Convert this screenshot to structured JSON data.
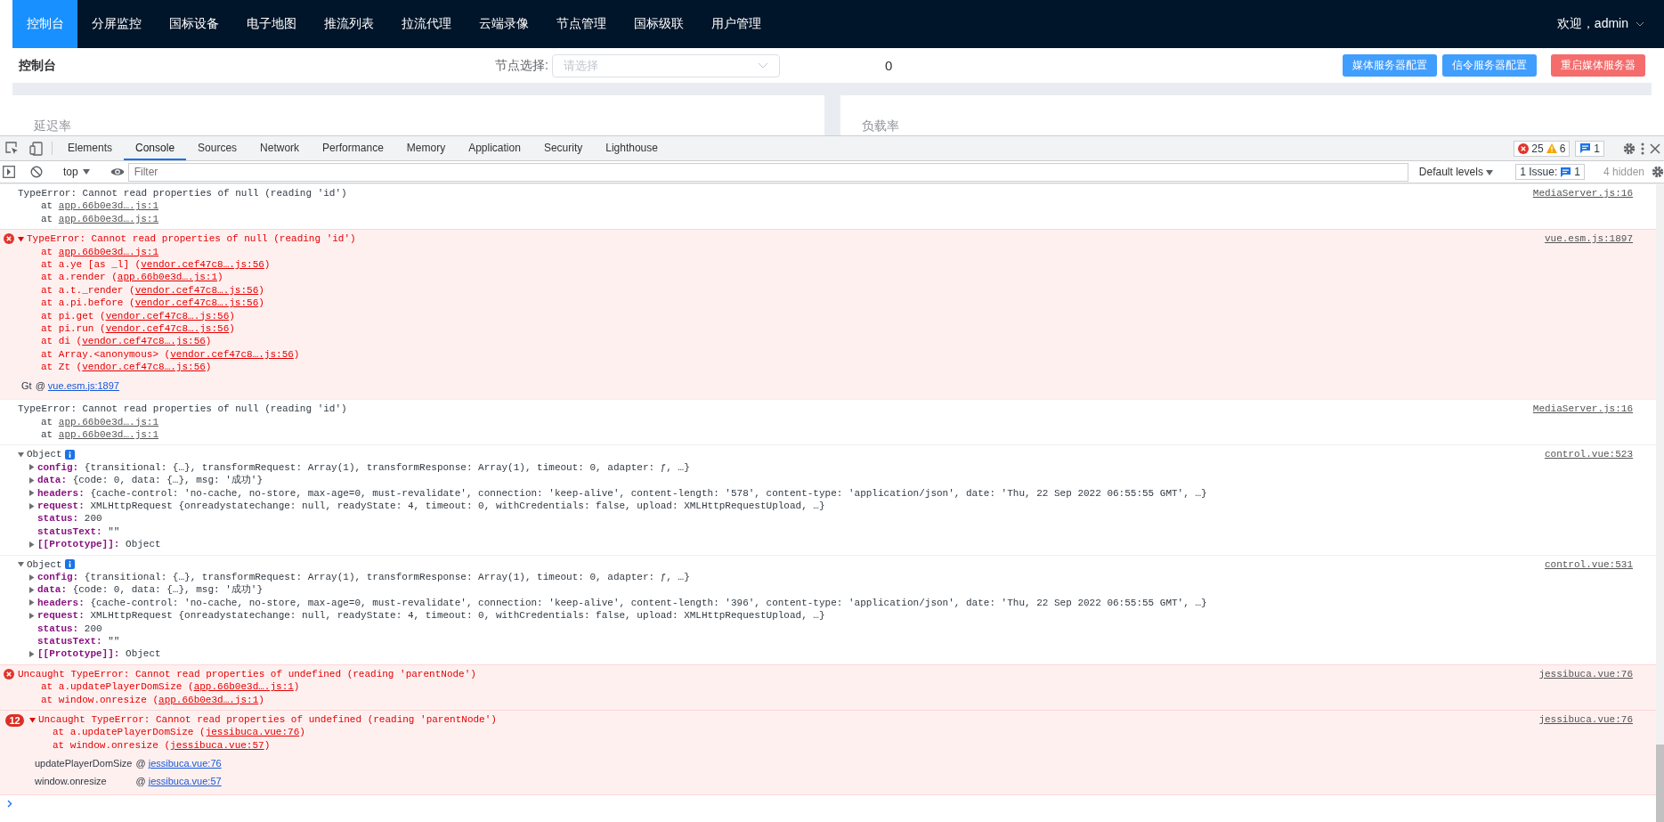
{
  "nav": {
    "items": [
      {
        "label": "控制台",
        "selected": true
      },
      {
        "label": "分屏监控",
        "selected": false
      },
      {
        "label": "国标设备",
        "selected": false
      },
      {
        "label": "电子地图",
        "selected": false
      },
      {
        "label": "推流列表",
        "selected": false
      },
      {
        "label": "拉流代理",
        "selected": false
      },
      {
        "label": "云端录像",
        "selected": false
      },
      {
        "label": "节点管理",
        "selected": false
      },
      {
        "label": "国标级联",
        "selected": false
      },
      {
        "label": "用户管理",
        "selected": false
      }
    ],
    "user": "欢迎，admin"
  },
  "header": {
    "title": "控制台",
    "node_label": "节点选择:",
    "node_placeholder": "请选择",
    "count": "0",
    "buttons": [
      {
        "label": "媒体服务器配置",
        "kind": "primary"
      },
      {
        "label": "信令服务器配置",
        "kind": "primary"
      },
      {
        "label": "重启媒体服务器",
        "kind": "danger"
      }
    ]
  },
  "cards": [
    {
      "title": "延迟率"
    },
    {
      "title": "负载率"
    }
  ],
  "devtools": {
    "tabs": [
      {
        "label": "Elements",
        "selected": false
      },
      {
        "label": "Console",
        "selected": true
      },
      {
        "label": "Sources",
        "selected": false
      },
      {
        "label": "Network",
        "selected": false
      },
      {
        "label": "Performance",
        "selected": false
      },
      {
        "label": "Memory",
        "selected": false
      },
      {
        "label": "Application",
        "selected": false
      },
      {
        "label": "Security",
        "selected": false
      },
      {
        "label": "Lighthouse",
        "selected": false
      }
    ],
    "errors": "25",
    "warnings": "6",
    "issues": "1",
    "context": "top",
    "filter_placeholder": "Filter",
    "levels": "Default levels",
    "issue_label": "1 Issue:",
    "issue_count": "1",
    "hidden": "4 hidden"
  },
  "console": [
    {
      "kind": "plain",
      "message": "TypeError: Cannot read properties of null (reading 'id')",
      "source": "MediaServer.js:16",
      "stack": [
        {
          "pre": "at ",
          "link": "app.66b0e3d….js:1"
        },
        {
          "pre": "at ",
          "link": "app.66b0e3d….js:1"
        }
      ]
    },
    {
      "kind": "error",
      "expanded": true,
      "message": "TypeError: Cannot read properties of null (reading 'id')",
      "source": "vue.esm.js:1897",
      "stack": [
        {
          "pre": "at ",
          "link": "app.66b0e3d….js:1"
        },
        {
          "pre": "at a.ye [as _l] (",
          "link": "vendor.cef47c8….js:56",
          "post": ")"
        },
        {
          "pre": "at a.render (",
          "link": "app.66b0e3d….js:1",
          "post": ")"
        },
        {
          "pre": "at a.t._render (",
          "link": "vendor.cef47c8….js:56",
          "post": ")"
        },
        {
          "pre": "at a.pi.before (",
          "link": "vendor.cef47c8….js:56",
          "post": ")"
        },
        {
          "pre": "at pi.get (",
          "link": "vendor.cef47c8….js:56",
          "post": ")"
        },
        {
          "pre": "at pi.run (",
          "link": "vendor.cef47c8….js:56",
          "post": ")"
        },
        {
          "pre": "at di (",
          "link": "vendor.cef47c8….js:56",
          "post": ")"
        },
        {
          "pre": "at Array.<anonymous> (",
          "link": "vendor.cef47c8….js:56",
          "post": ")"
        },
        {
          "pre": "at Zt (",
          "link": "vendor.cef47c8….js:56",
          "post": ")"
        }
      ],
      "frames": [
        {
          "fn": "Gt",
          "sep": "@",
          "link": "vue.esm.js:1897"
        }
      ]
    },
    {
      "kind": "plain",
      "message": "TypeError: Cannot read properties of null (reading 'id')",
      "source": "MediaServer.js:16",
      "stack": [
        {
          "pre": "at ",
          "link": "app.66b0e3d….js:1"
        },
        {
          "pre": "at ",
          "link": "app.66b0e3d….js:1"
        }
      ]
    },
    {
      "kind": "object",
      "expanded": true,
      "message": "Object",
      "source": "control.vue:523",
      "props": [
        {
          "key": "config:",
          "expandable": true,
          "value": "{transitional: {…}, transformRequest: Array(1), transformResponse: Array(1), timeout: 0, adapter: ƒ, …}"
        },
        {
          "key": "data:",
          "expandable": true,
          "value": "{code: 0, data: {…}, msg: '成功'}"
        },
        {
          "key": "headers:",
          "expandable": true,
          "value": "{cache-control: 'no-cache, no-store, max-age=0, must-revalidate', connection: 'keep-alive', content-length: '578', content-type: 'application/json', date: 'Thu, 22 Sep 2022 06:55:55 GMT', …}"
        },
        {
          "key": "request:",
          "expandable": true,
          "value": "XMLHttpRequest {onreadystatechange: null, readyState: 4, timeout: 0, withCredentials: false, upload: XMLHttpRequestUpload, …}"
        },
        {
          "key": "status:",
          "expandable": false,
          "value": "200"
        },
        {
          "key": "statusText:",
          "expandable": false,
          "value": "\"\""
        },
        {
          "key": "[[Prototype]]:",
          "expandable": true,
          "value": "Object"
        }
      ]
    },
    {
      "kind": "object",
      "expanded": true,
      "message": "Object",
      "source": "control.vue:531",
      "props": [
        {
          "key": "config:",
          "expandable": true,
          "value": "{transitional: {…}, transformRequest: Array(1), transformResponse: Array(1), timeout: 0, adapter: ƒ, …}"
        },
        {
          "key": "data:",
          "expandable": true,
          "value": "{code: 0, data: {…}, msg: '成功'}"
        },
        {
          "key": "headers:",
          "expandable": true,
          "value": "{cache-control: 'no-cache, no-store, max-age=0, must-revalidate', connection: 'keep-alive', content-length: '396', content-type: 'application/json', date: 'Thu, 22 Sep 2022 06:55:55 GMT', …}"
        },
        {
          "key": "request:",
          "expandable": true,
          "value": "XMLHttpRequest {onreadystatechange: null, readyState: 4, timeout: 0, withCredentials: false, upload: XMLHttpRequestUpload, …}"
        },
        {
          "key": "status:",
          "expandable": false,
          "value": "200"
        },
        {
          "key": "statusText:",
          "expandable": false,
          "value": "\"\""
        },
        {
          "key": "[[Prototype]]:",
          "expandable": true,
          "value": "Object"
        }
      ]
    },
    {
      "kind": "error",
      "message": "Uncaught TypeError: Cannot read properties of undefined (reading 'parentNode')",
      "source": "jessibuca.vue:76",
      "stack": [
        {
          "pre": "at a.updatePlayerDomSize (",
          "link": "app.66b0e3d….js:1",
          "post": ")"
        },
        {
          "pre": "at window.onresize (",
          "link": "app.66b0e3d….js:1",
          "post": ")"
        }
      ]
    },
    {
      "kind": "error",
      "expanded": true,
      "count": "12",
      "message": "Uncaught TypeError: Cannot read properties of undefined (reading 'parentNode')",
      "source": "jessibuca.vue:76",
      "stack": [
        {
          "pre": "at a.updatePlayerDomSize (",
          "link": "jessibuca.vue:76",
          "post": ")"
        },
        {
          "pre": "at window.onresize (",
          "link": "jessibuca.vue:57",
          "post": ")"
        }
      ],
      "frames": [
        {
          "fn": "updatePlayerDomSize",
          "sep": "@",
          "link": "jessibuca.vue:76"
        },
        {
          "fn": "window.onresize",
          "sep": "@",
          "link": "jessibuca.vue:57"
        }
      ]
    }
  ]
}
